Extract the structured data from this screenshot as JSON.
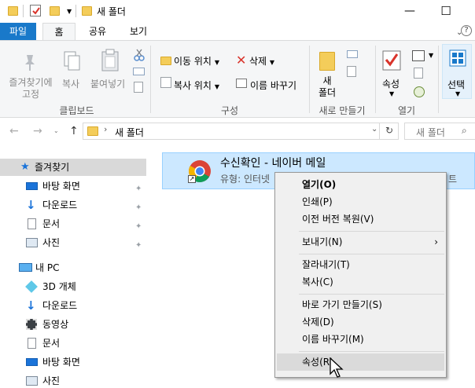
{
  "window": {
    "title": "새 폴더",
    "minimize": "—",
    "maximize": "☐",
    "close": "✕"
  },
  "ribbon_tabs": [
    "파일",
    "홈",
    "공유",
    "보기"
  ],
  "help_label": "?",
  "ribbon": {
    "clipboard": {
      "pin_label": "즐겨찾기에\n고정",
      "copy_label": "복사",
      "paste_label": "붙여넣기",
      "group": "클립보드"
    },
    "organize": {
      "move_to": "이동 위치",
      "copy_to": "복사 위치",
      "delete": "삭제",
      "rename": "이름 바꾸기",
      "group": "구성"
    },
    "new": {
      "new_folder": "새\n폴더",
      "group": "새로 만들기"
    },
    "open": {
      "properties": "속성",
      "group": "열기"
    },
    "select": {
      "select_label": "선택"
    }
  },
  "address": {
    "path": "새 폴더",
    "search_placeholder": "새 폴더"
  },
  "sidebar": {
    "quick_access": "즐겨찾기",
    "quick_items": [
      "바탕 화면",
      "다운로드",
      "문서",
      "사진"
    ],
    "this_pc": "내 PC",
    "pc_items": [
      "3D 개체",
      "다운로드",
      "동영상",
      "문서",
      "바탕 화면",
      "사진"
    ]
  },
  "file": {
    "name": "수신확인 - 네이버 메일",
    "type_label": "유형: 인터넷",
    "type_suffix": "트"
  },
  "context_menu": {
    "groups": [
      [
        "열기(O)",
        "인쇄(P)",
        "이전 버전 복원(V)"
      ],
      [
        "보내기(N)"
      ],
      [
        "잘라내기(T)",
        "복사(C)"
      ],
      [
        "바로 가기 만들기(S)",
        "삭제(D)",
        "이름 바꾸기(M)"
      ],
      [
        "속성(R)"
      ]
    ],
    "submenu_arrow": "›"
  },
  "colors": {
    "accent": "#1979ca",
    "selection": "#cce8ff",
    "folder": "#f4cd5a"
  }
}
